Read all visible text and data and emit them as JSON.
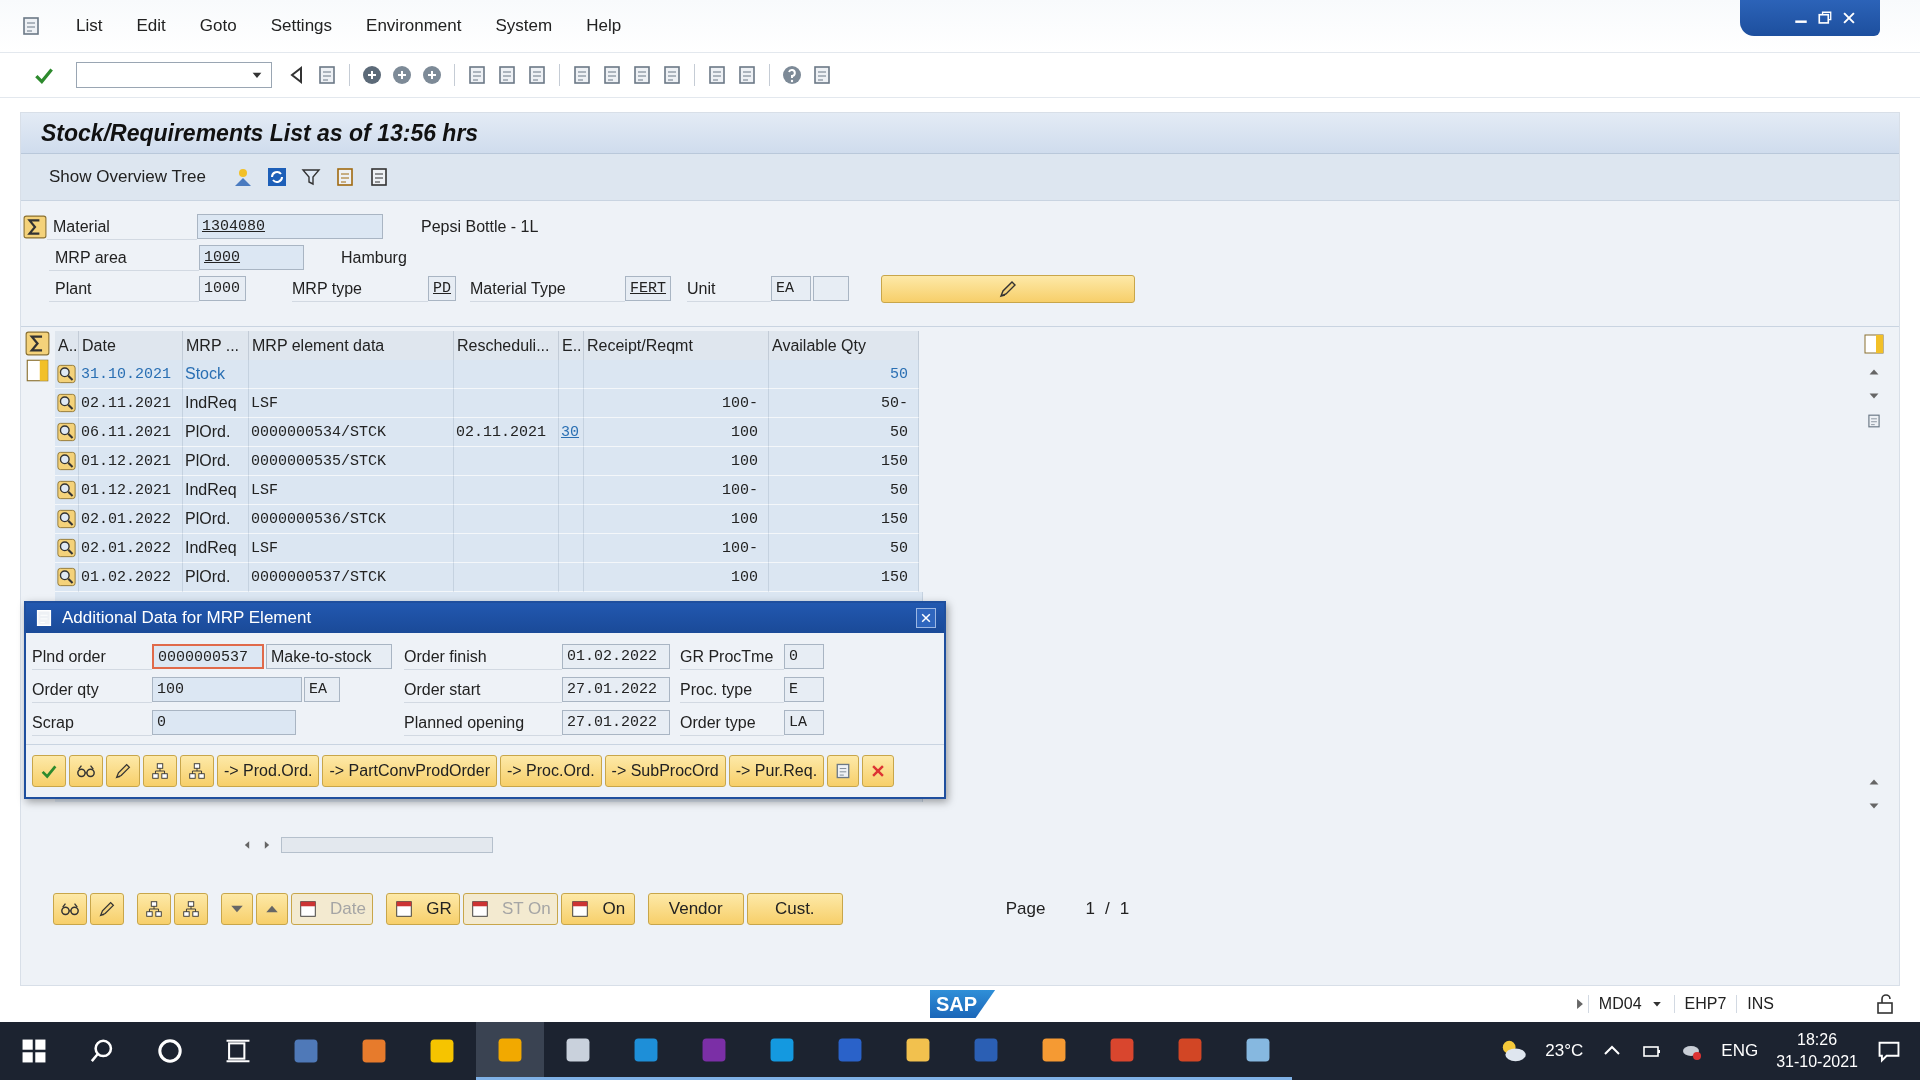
{
  "menu": [
    "List",
    "Edit",
    "Goto",
    "Settings",
    "Environment",
    "System",
    "Help"
  ],
  "title": "Stock/Requirements List as of 13:56 hrs",
  "app_toolbar": {
    "button": "Show Overview Tree"
  },
  "header": {
    "material": {
      "label": "Material",
      "value": "1304080",
      "description": "Pepsi Bottle - 1L"
    },
    "mrp_area": {
      "label": "MRP area",
      "value": "1000",
      "description": "Hamburg"
    },
    "plant": {
      "label": "Plant",
      "value": "1000"
    },
    "mrp_type": {
      "label": "MRP type",
      "value": "PD"
    },
    "material_type": {
      "label": "Material Type",
      "value": "FERT"
    },
    "unit": {
      "label": "Unit",
      "value": "EA"
    }
  },
  "table": {
    "columns": [
      "A..",
      "Date",
      "MRP ...",
      "MRP element data",
      "Rescheduli...",
      "E..",
      "Receipt/Reqmt",
      "Available Qty"
    ],
    "rows": [
      {
        "date": "31.10.2021",
        "mrp": "Stock",
        "element_data": "",
        "rescheduling": "",
        "exception": "",
        "receipt_reqmt": "",
        "available_qty": "50",
        "highlighted": true
      },
      {
        "date": "02.11.2021",
        "mrp": "IndReq",
        "element_data": "LSF",
        "rescheduling": "",
        "exception": "",
        "receipt_reqmt": "100-",
        "available_qty": "50-",
        "highlighted": false
      },
      {
        "date": "06.11.2021",
        "mrp": "PlOrd.",
        "element_data": "0000000534/STCK",
        "rescheduling": "02.11.2021",
        "exception": "30",
        "receipt_reqmt": "100",
        "available_qty": "50",
        "highlighted": false
      },
      {
        "date": "01.12.2021",
        "mrp": "PlOrd.",
        "element_data": "0000000535/STCK",
        "rescheduling": "",
        "exception": "",
        "receipt_reqmt": "100",
        "available_qty": "150",
        "highlighted": false
      },
      {
        "date": "01.12.2021",
        "mrp": "IndReq",
        "element_data": "LSF",
        "rescheduling": "",
        "exception": "",
        "receipt_reqmt": "100-",
        "available_qty": "50",
        "highlighted": false
      },
      {
        "date": "02.01.2022",
        "mrp": "PlOrd.",
        "element_data": "0000000536/STCK",
        "rescheduling": "",
        "exception": "",
        "receipt_reqmt": "100",
        "available_qty": "150",
        "highlighted": false
      },
      {
        "date": "02.01.2022",
        "mrp": "IndReq",
        "element_data": "LSF",
        "rescheduling": "",
        "exception": "",
        "receipt_reqmt": "100-",
        "available_qty": "50",
        "highlighted": false
      },
      {
        "date": "01.02.2022",
        "mrp": "PlOrd.",
        "element_data": "0000000537/STCK",
        "rescheduling": "",
        "exception": "",
        "receipt_reqmt": "100",
        "available_qty": "150",
        "highlighted": false
      }
    ]
  },
  "dialog": {
    "title": "Additional Data for MRP Element",
    "columns": [
      [
        {
          "label": "Plnd order",
          "value": "0000000537",
          "extra": "Make-to-stock",
          "focused": true
        },
        {
          "label": "Order qty",
          "value": "100",
          "extra": "EA",
          "focused": false
        },
        {
          "label": "Scrap",
          "value": "0",
          "focused": false
        }
      ],
      [
        {
          "label": "Order finish",
          "value": "01.02.2022",
          "focused": false
        },
        {
          "label": "Order start",
          "value": "27.01.2022",
          "focused": false
        },
        {
          "label": "Planned opening",
          "value": "27.01.2022",
          "focused": false
        }
      ],
      [
        {
          "label": "GR ProcTme",
          "value": "0",
          "focused": false
        },
        {
          "label": "Proc. type",
          "value": "E",
          "focused": false
        },
        {
          "label": "Order type",
          "value": "LA",
          "focused": false
        }
      ]
    ],
    "buttons": [
      "-> Prod.Ord.",
      "-> PartConvProdOrder",
      "-> Proc.Ord.",
      "-> SubProcOrd",
      "-> Pur.Req."
    ]
  },
  "bottom_buttons": [
    {
      "kind": "icon_text",
      "label": "Date",
      "disabled": true
    },
    {
      "kind": "icon_text",
      "label": "GR",
      "disabled": false
    },
    {
      "kind": "icon_text",
      "label": "ST On",
      "disabled": true
    },
    {
      "kind": "icon_text",
      "label": "On",
      "disabled": false
    },
    {
      "kind": "text",
      "label": "Vendor",
      "disabled": false
    },
    {
      "kind": "text",
      "label": "Cust.",
      "disabled": false
    }
  ],
  "page": {
    "label": "Page",
    "current": "1",
    "separator": "/",
    "total": "1"
  },
  "status_bar": {
    "logo": "SAP",
    "transaction": "MD04",
    "system": "EHP7",
    "mode": "INS"
  },
  "taskbar": {
    "weather": "23°C",
    "language": "ENG",
    "time": "18:26",
    "date": "31-10-2021"
  }
}
